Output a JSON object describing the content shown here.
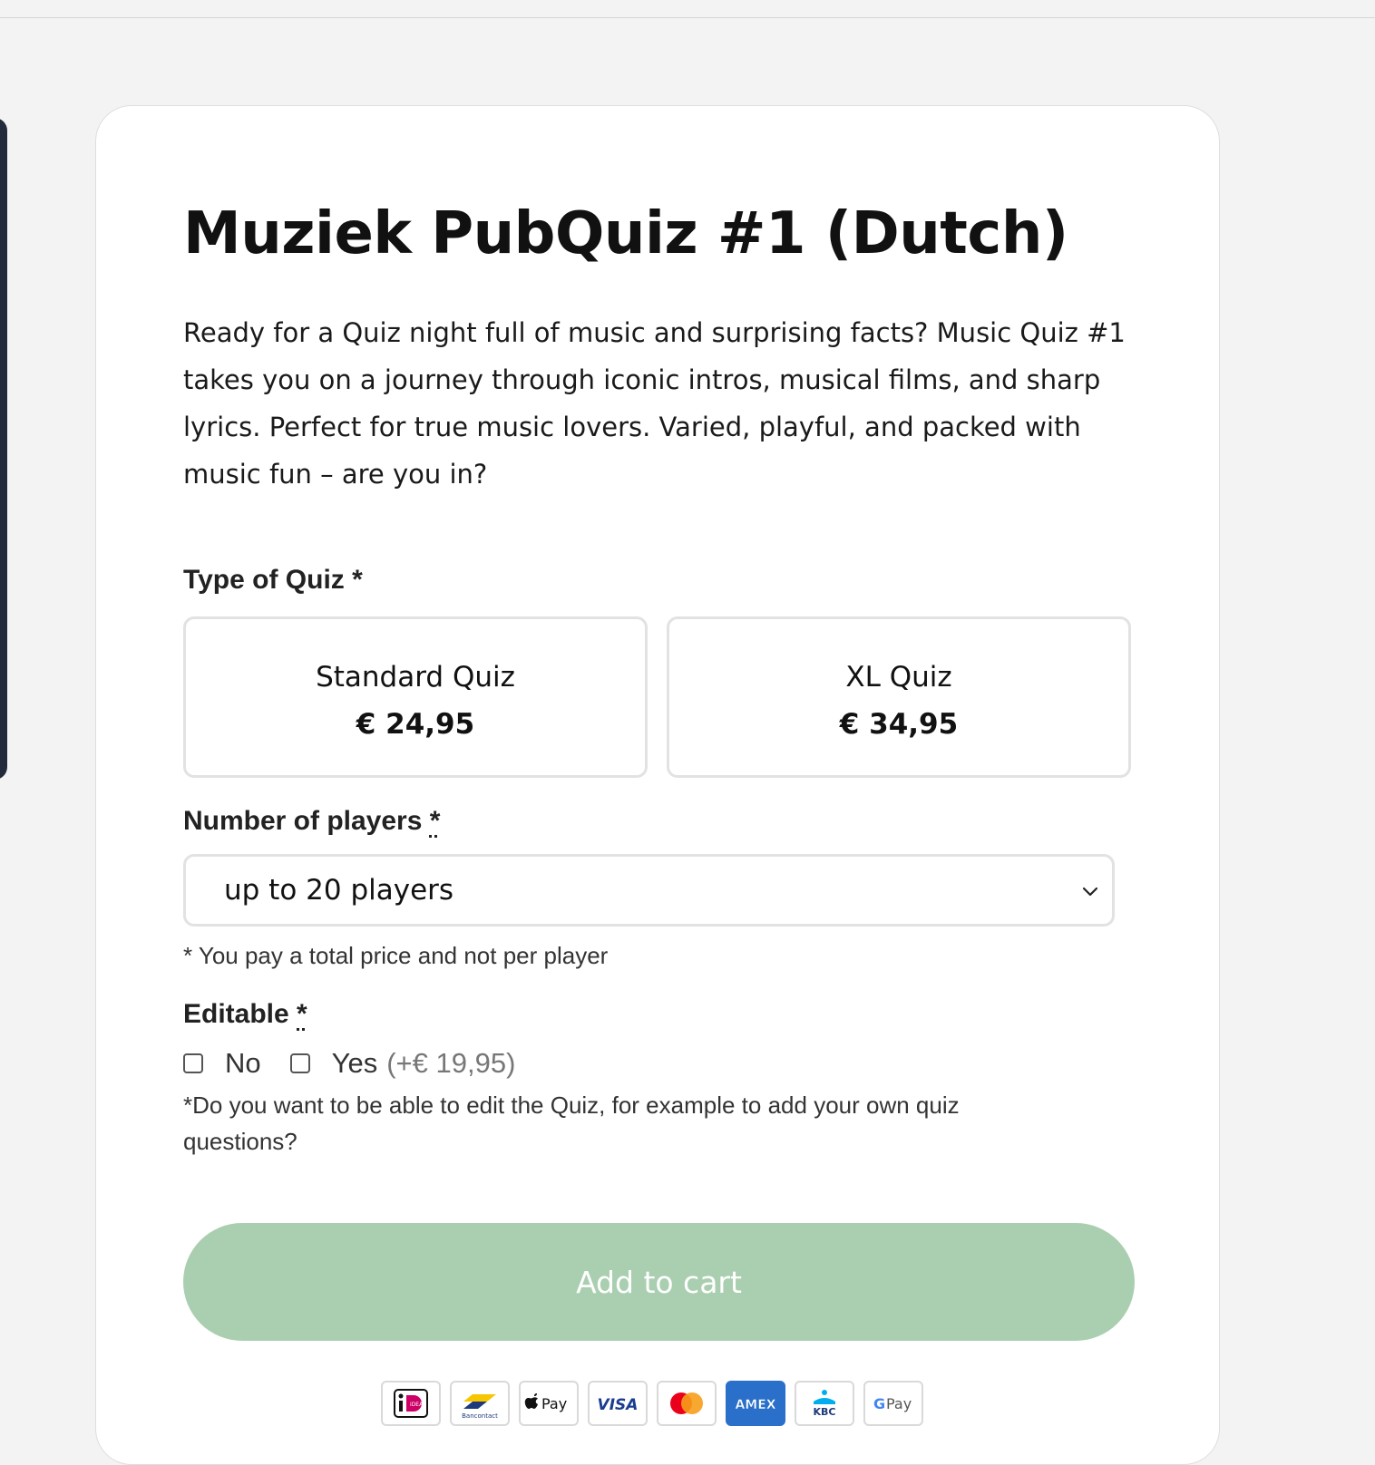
{
  "product": {
    "title": "Muziek PubQuiz #1 (Dutch)",
    "description": "Ready for a Quiz night full of music and surprising facts? Music Quiz #1 takes you on a journey through iconic intros, musical films, and sharp lyrics. Perfect for true music lovers. Varied, playful, and packed with music fun – are you in?"
  },
  "quiz_type": {
    "label": "Type of Quiz *",
    "options": [
      {
        "name": "Standard Quiz",
        "price": "€ 24,95"
      },
      {
        "name": "XL Quiz",
        "price": "€ 34,95"
      }
    ]
  },
  "players": {
    "label": "Number of players",
    "required_mark": "*",
    "selected": "up to 20 players",
    "note": "* You pay a total price and not per player"
  },
  "editable": {
    "label": "Editable",
    "required_mark": "*",
    "options": [
      {
        "label": "No",
        "extra": ""
      },
      {
        "label": "Yes",
        "extra": "(+€ 19,95)"
      }
    ],
    "note": "*Do you want to be able to edit the Quiz, for example to add your own quiz questions?"
  },
  "cart": {
    "label": "Add to cart",
    "color": "#aacfb0"
  },
  "payment_methods": [
    {
      "icon": "ideal-icon",
      "text": "iDEAL"
    },
    {
      "icon": "bancontact-icon",
      "text": "Bancontact"
    },
    {
      "icon": "apple-pay-icon",
      "text": "Pay"
    },
    {
      "icon": "visa-icon",
      "text": "VISA"
    },
    {
      "icon": "mastercard-icon",
      "text": ""
    },
    {
      "icon": "amex-icon",
      "text": "AMEX"
    },
    {
      "icon": "kbc-icon",
      "text": "KBC"
    },
    {
      "icon": "google-pay-icon",
      "text": "Pay"
    }
  ]
}
